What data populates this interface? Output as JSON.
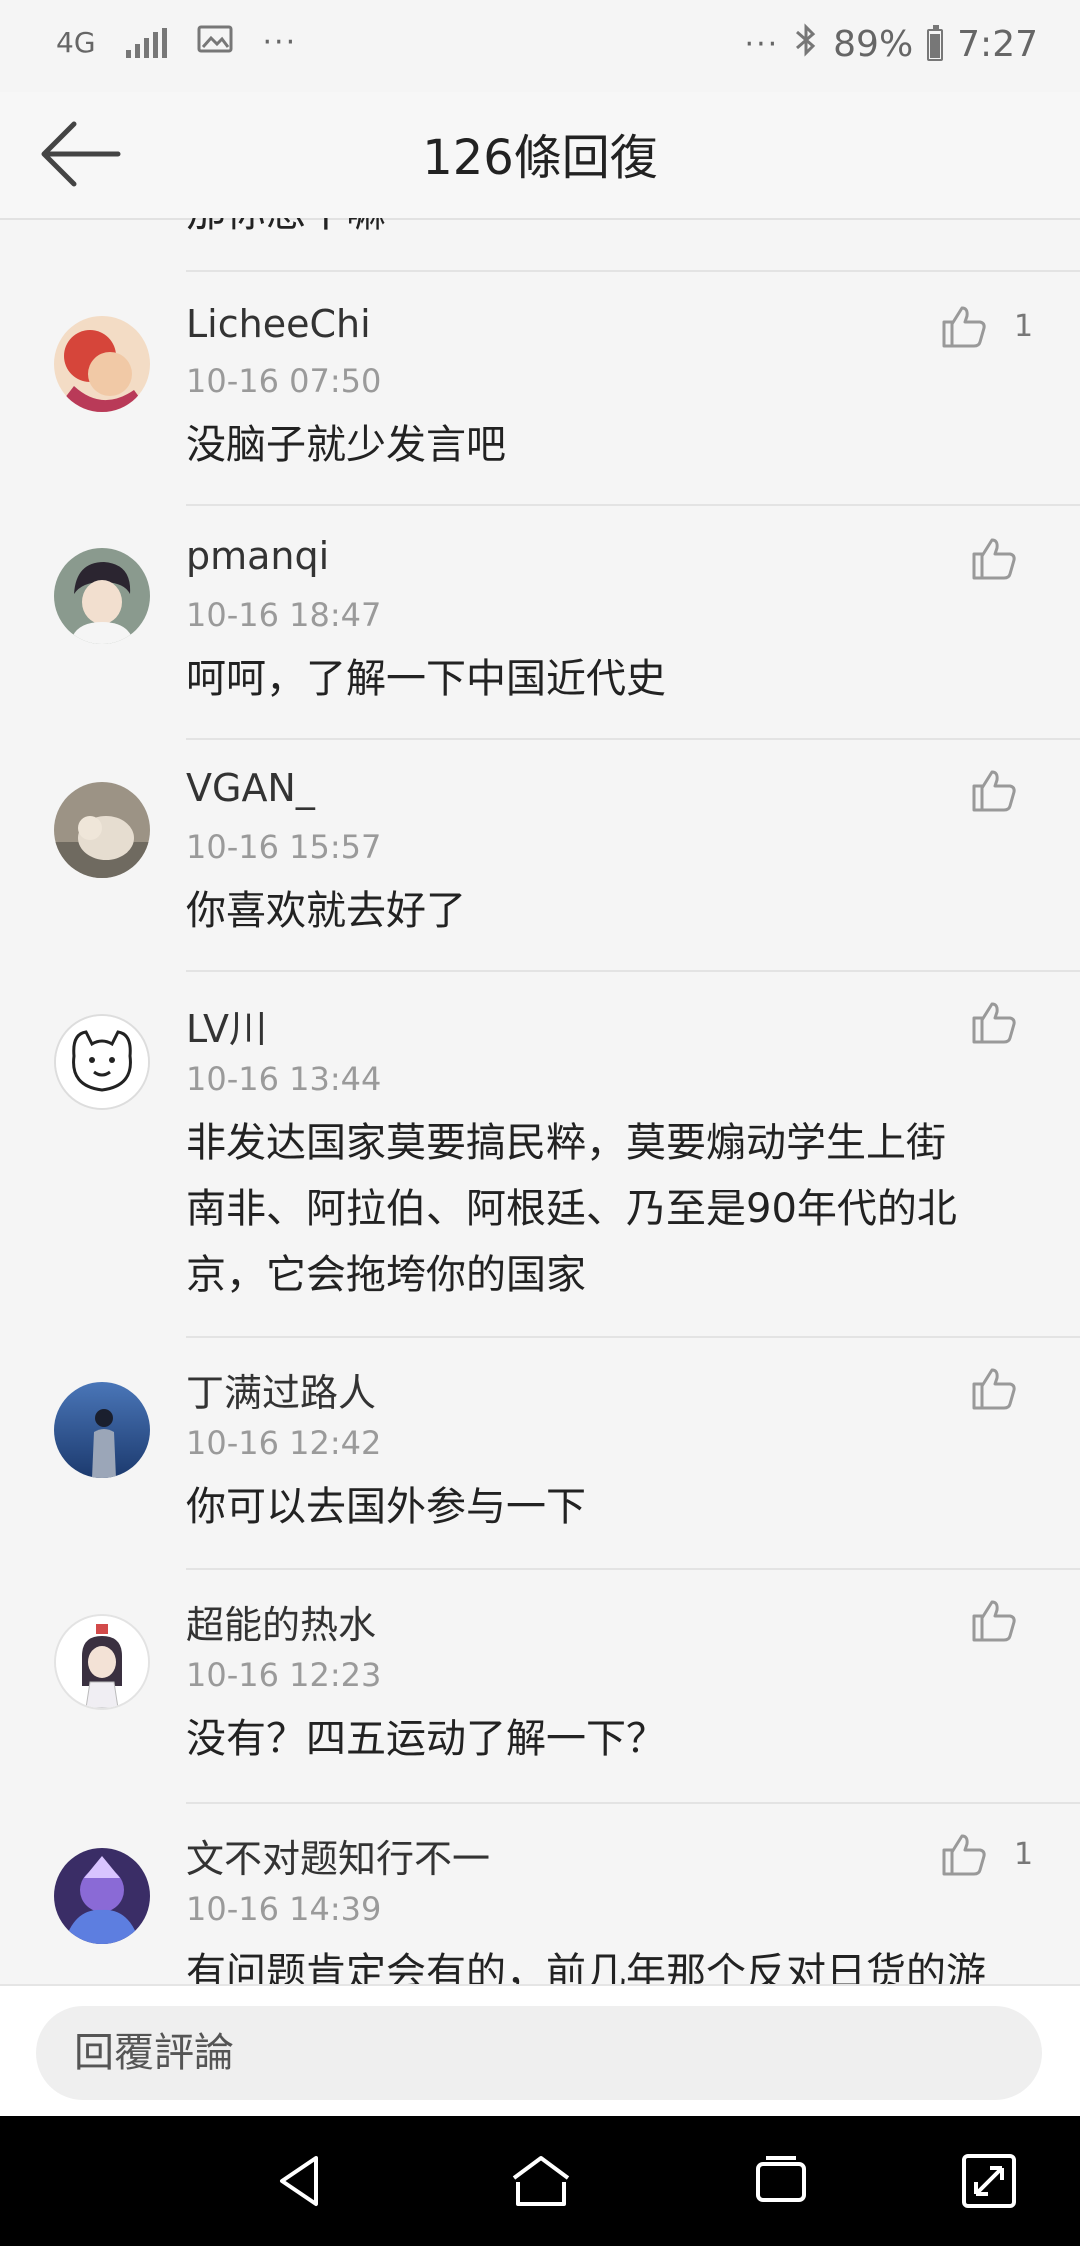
{
  "status_bar": {
    "network": "4G",
    "battery": "89%",
    "time": "7:27",
    "icons": [
      "network-4g-icon",
      "signal-icon",
      "image-icon",
      "more-icon",
      "bluetooth-icon",
      "battery-icon"
    ]
  },
  "header": {
    "title": "126條回復",
    "back_icon": "back-arrow-icon"
  },
  "cutoff_text": "那你想干嘛",
  "comments": [
    {
      "username": "LicheeChi",
      "time": "10-16 07:50",
      "content": "没脑子就少发言吧",
      "likes": "1"
    },
    {
      "username": "pmanqi",
      "time": "10-16 18:47",
      "content": "呵呵，了解一下中国近代史",
      "likes": ""
    },
    {
      "username": "VGAN_",
      "time": "10-16 15:57",
      "content": "你喜欢就去好了",
      "likes": ""
    },
    {
      "username": "LV川",
      "time": "10-16 13:44",
      "content_lines": [
        "非发达国家莫要搞民粹，莫要煽动学生上街",
        "南非、阿拉伯、阿根廷、乃至是90年代的北",
        "京，它会拖垮你的国家"
      ],
      "likes": ""
    },
    {
      "username": "丁满过路人",
      "time": "10-16 12:42",
      "content": "你可以去国外参与一下",
      "likes": ""
    },
    {
      "username": "超能的热水",
      "time": "10-16 12:23",
      "content": "没有？四五运动了解一下？",
      "likes": ""
    },
    {
      "username": "文不对题知行不一",
      "time": "10-16 14:39",
      "content": "有问题肯定会有的，前几年那个反对日货的游",
      "likes": "1"
    }
  ],
  "reply_bar": {
    "placeholder": "回覆評論"
  },
  "nav_bar": {
    "icons": [
      "back-triangle-icon",
      "home-icon",
      "recents-icon",
      "rotate-screen-icon"
    ]
  }
}
